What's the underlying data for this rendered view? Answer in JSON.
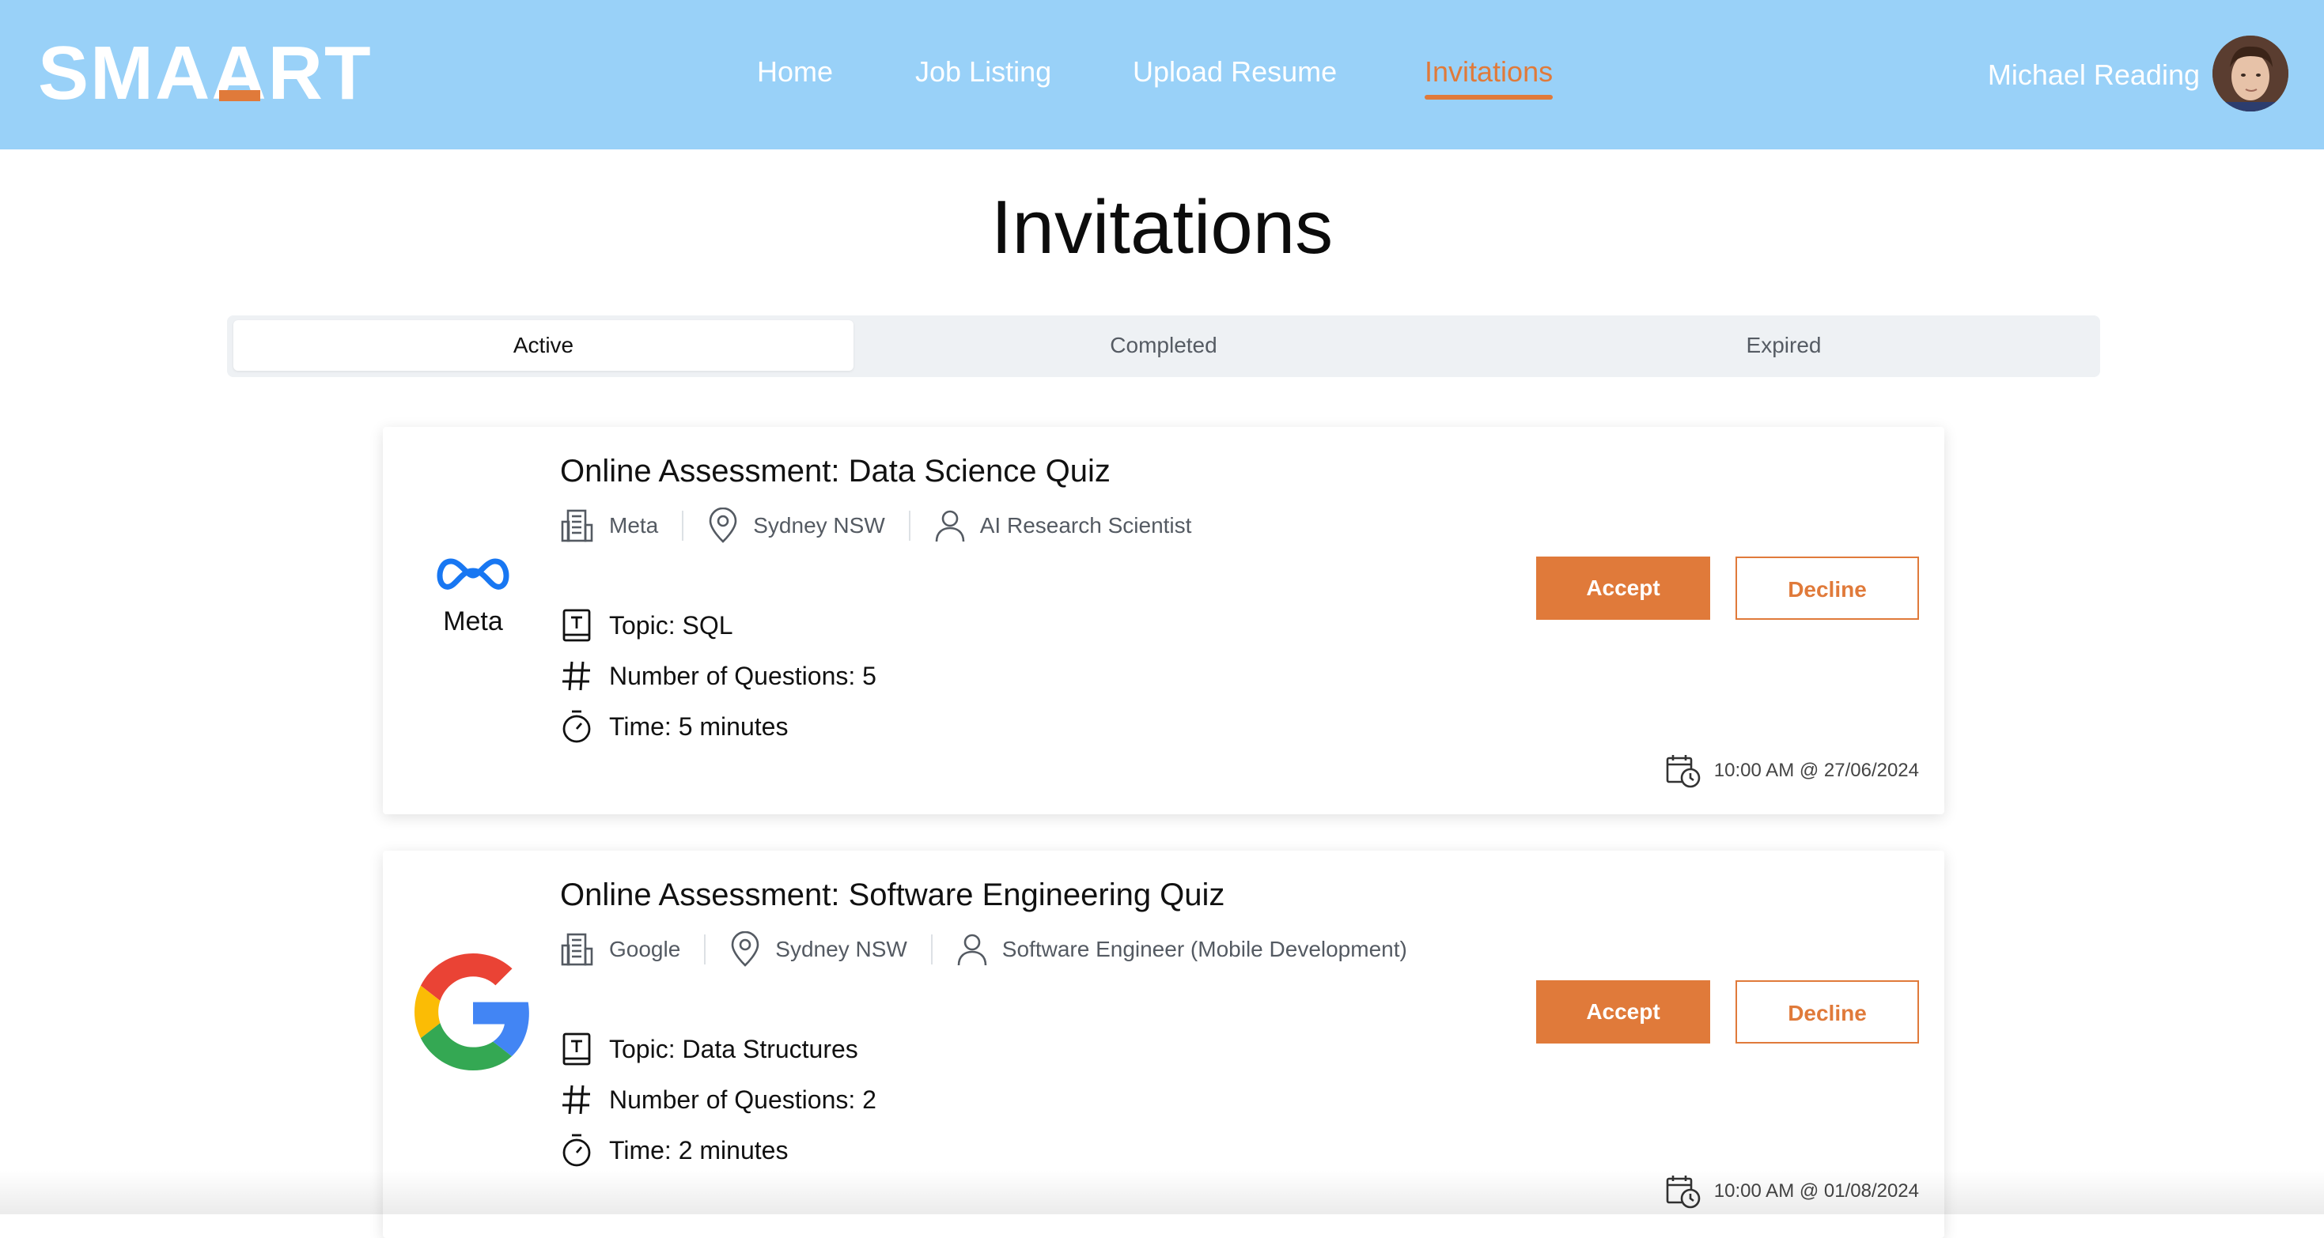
{
  "brand": {
    "logo_text": "SMAART",
    "accent_color": "#e07a3a",
    "header_color": "#99d1f8"
  },
  "nav": {
    "items": [
      {
        "label": "Home",
        "active": false
      },
      {
        "label": "Job Listing",
        "active": false
      },
      {
        "label": "Upload Resume",
        "active": false
      },
      {
        "label": "Invitations",
        "active": true
      }
    ]
  },
  "user": {
    "name": "Michael Reading"
  },
  "page": {
    "title": "Invitations"
  },
  "tabs": [
    {
      "label": "Active",
      "active": true
    },
    {
      "label": "Completed",
      "active": false
    },
    {
      "label": "Expired",
      "active": false
    }
  ],
  "invitations": [
    {
      "title": "Online Assessment: Data Science Quiz",
      "company": "Meta",
      "company_logo_text": "Meta",
      "location": "Sydney NSW",
      "role": "AI Research Scientist",
      "topic": "Topic: SQL",
      "questions": "Number of Questions: 5",
      "time": "Time: 5 minutes",
      "accept_label": "Accept",
      "decline_label": "Decline",
      "datetime": "10:00 AM @ 27/06/2024"
    },
    {
      "title": "Online Assessment: Software Engineering Quiz",
      "company": "Google",
      "location": "Sydney NSW",
      "role": "Software Engineer (Mobile Development)",
      "topic": "Topic: Data Structures",
      "questions": "Number of Questions: 2",
      "time": "Time: 2 minutes",
      "accept_label": "Accept",
      "decline_label": "Decline",
      "datetime": "10:00 AM @ 01/08/2024"
    }
  ]
}
